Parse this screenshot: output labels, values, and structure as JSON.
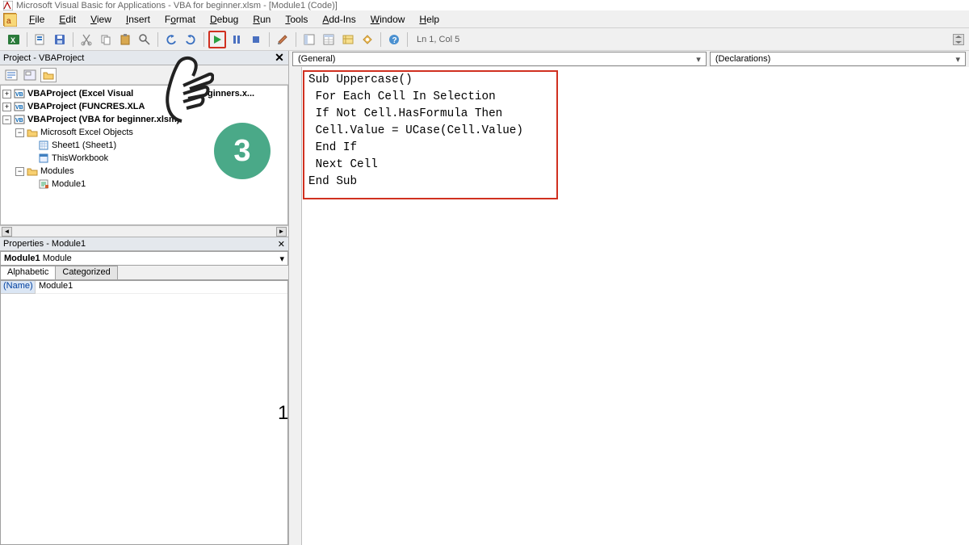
{
  "window": {
    "title": "Microsoft Visual Basic for Applications - VBA for beginner.xlsm - [Module1 (Code)]"
  },
  "menus": {
    "file": "File",
    "edit": "Edit",
    "view": "View",
    "insert": "Insert",
    "format": "Format",
    "debug": "Debug",
    "run": "Run",
    "tools": "Tools",
    "addins": "Add-Ins",
    "window": "Window",
    "help": "Help"
  },
  "toolbar": {
    "status": "Ln 1, Col 5"
  },
  "project_panel": {
    "title": "Project - VBAProject"
  },
  "tree": {
    "proj1": "VBAProject (Excel Visual",
    "proj1_suffix": "for Beginners.x...",
    "proj2": "VBAProject (FUNCRES.XLA",
    "proj3": "VBAProject (VBA for beginner.xlsm)",
    "folder_excel_objects": "Microsoft Excel Objects",
    "sheet1": "Sheet1 (Sheet1)",
    "thisworkbook": "ThisWorkbook",
    "folder_modules": "Modules",
    "module1": "Module1"
  },
  "props_panel": {
    "title": "Properties - Module1",
    "object_name": "Module1",
    "object_type": "Module",
    "tab_alpha": "Alphabetic",
    "tab_cat": "Categorized",
    "row_name_label": "(Name)",
    "row_name_value": "Module1"
  },
  "code_dropdowns": {
    "left": "(General)",
    "right": "(Declarations)"
  },
  "code": {
    "l1": "Sub Uppercase()",
    "l2": " For Each Cell In Selection",
    "l3": " If Not Cell.HasFormula Then",
    "l4": " Cell.Value = UCase(Cell.Value)",
    "l5": " End If",
    "l6": " Next Cell",
    "l7": "End Sub"
  },
  "annotations": {
    "circle": "3",
    "num1": "1"
  }
}
